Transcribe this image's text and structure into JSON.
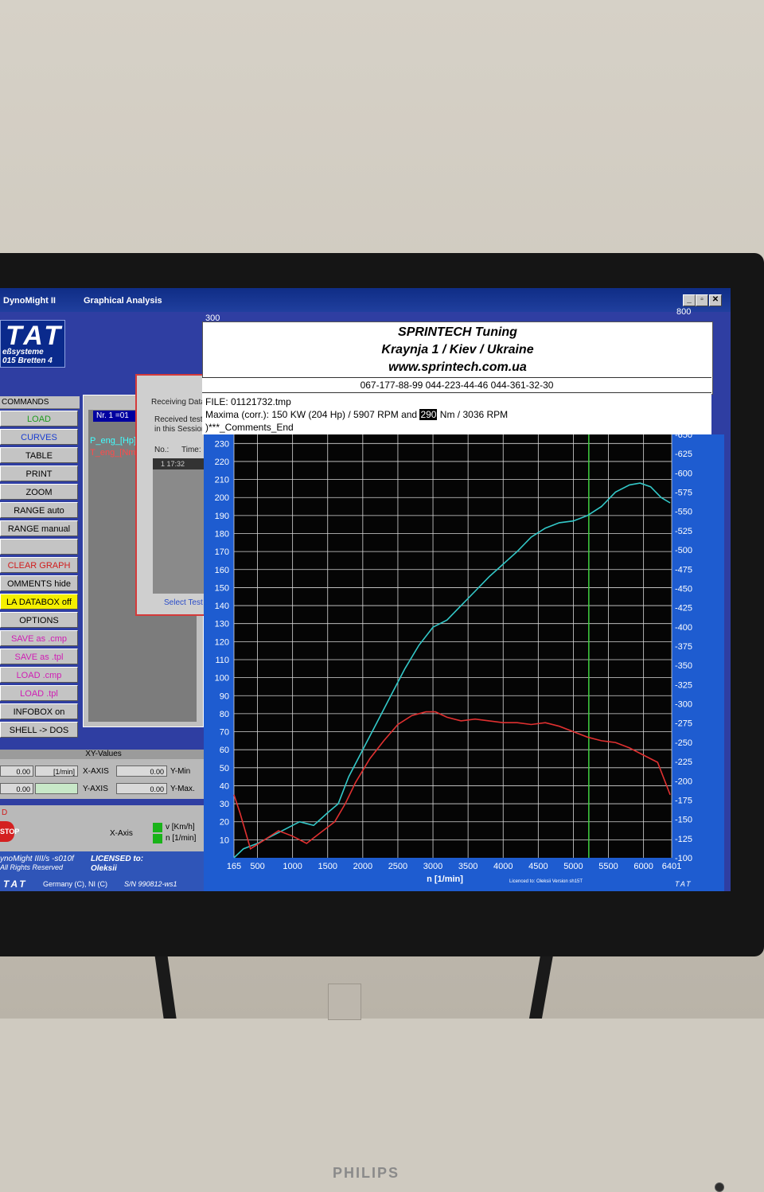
{
  "app": {
    "title": "DynoMight II",
    "menu_graphical": "Graphical Analysis",
    "logo_text": "TAT",
    "logo_sub1": "eßsysteme",
    "logo_sub2": "015 Bretten 4",
    "monitor_brand": "PHILIPS"
  },
  "window_buttons": [
    "_",
    "▫",
    "✕"
  ],
  "commands": {
    "header": "COMMANDS",
    "items": [
      {
        "label": "LOAD",
        "color": "#1e9a1e"
      },
      {
        "label": "CURVES",
        "color": "#1a3ed0"
      },
      {
        "label": "TABLE",
        "color": "#000000"
      },
      {
        "label": "PRINT",
        "color": "#000000"
      },
      {
        "label": "ZOOM",
        "color": "#000000"
      },
      {
        "label": "RANGE   auto",
        "color": "#000000"
      },
      {
        "label": "RANGE manual",
        "color": "#000000"
      },
      {
        "label": "",
        "color": "#000000"
      },
      {
        "label": "CLEAR GRAPH",
        "color": "#d01c1c"
      },
      {
        "label": "OMMENTS  hide",
        "color": "#000000"
      },
      {
        "label": "LA DATABOX  off",
        "color": "#000000",
        "bg": "#f5f000"
      },
      {
        "label": "OPTIONS",
        "color": "#000000"
      },
      {
        "label": "SAVE as .cmp",
        "color": "#d01cb4"
      },
      {
        "label": "SAVE as  .tpl",
        "color": "#d01cb4"
      },
      {
        "label": "LOAD  .cmp",
        "color": "#d01cb4"
      },
      {
        "label": "LOAD  .tpl",
        "color": "#d01cb4"
      },
      {
        "label": "INFOBOX on",
        "color": "#000000"
      },
      {
        "label": "SHELL -> DOS",
        "color": "#000000"
      }
    ]
  },
  "list_panel": {
    "nr": "Nr. 1 =01",
    "p_eng": "P_eng_[Hp]",
    "t_eng": "T_eng_[Nm"
  },
  "dialog": {
    "receiving": "Receiving Data",
    "received": "Received test",
    "session": "in this Session",
    "col_no": "No.:",
    "col_time": "Time:",
    "row": "1    17:32",
    "select": "Select Test"
  },
  "xy": {
    "header": "XY-Values",
    "val1": "0.00",
    "unit1": "[1/min]",
    "xaxis": "X-AXIS",
    "ymin_val": "0.00",
    "ymin": "Y-Min",
    "val2": "0.00",
    "yaxis": "Y-AXIS",
    "ymax_val": "0.00",
    "ymax": "Y-Max."
  },
  "bottom": {
    "top_label": "D",
    "stop": "STOP",
    "xaxis": "X-Axis",
    "v": "v  [Km/h]",
    "n": "n  [1/min]"
  },
  "footer": {
    "prog": "ynoMight IIII/s -s010f",
    "rights": "All Rights Reserved",
    "licensed": "LICENSED to:",
    "name": "Oleksii",
    "tat": "TAT",
    "country": "Germany (C), NI (C)",
    "sn": "S/N  990812-ws1"
  },
  "header_block": {
    "line1": "SPRINTECH Tuning",
    "line2": "Kraynja 1 / Kiev / Ukraine",
    "line3": "www.sprintech.com.ua",
    "phones": "067-177-88-99 044-223-44-46 044-361-32-30"
  },
  "info": {
    "file": "FILE:  01121732.tmp",
    "maxima_a": "Maxima (corr.):  150 KW (204 Hp) /  5907 RPM   and   ",
    "maxima_hl": "290",
    "maxima_b": " Nm /  3036 RPM",
    "comments": ")***_Comments_End"
  },
  "axis_top": {
    "left": "300",
    "right": "800"
  },
  "chart_data": {
    "type": "line",
    "title": "",
    "xlabel": "n  [1/min]",
    "ylabel": "",
    "x_ticks": [
      165,
      500,
      1000,
      1500,
      2000,
      2500,
      3000,
      3500,
      4000,
      4500,
      5000,
      5500,
      6000,
      6401
    ],
    "xlim": [
      165,
      6401
    ],
    "ylim_left": [
      0,
      235
    ],
    "yticks_left": [
      10,
      20,
      30,
      40,
      50,
      60,
      70,
      80,
      90,
      100,
      110,
      120,
      130,
      140,
      150,
      160,
      170,
      180,
      190,
      200,
      210,
      220,
      230
    ],
    "ylim_right": [
      100,
      650
    ],
    "yticks_right": [
      100,
      125,
      150,
      175,
      200,
      225,
      250,
      275,
      300,
      325,
      350,
      375,
      400,
      425,
      450,
      475,
      500,
      525,
      550,
      575,
      600,
      625,
      650
    ],
    "grid": true,
    "cursor_x": 5220,
    "footer_note": "Licenced to: Oleksii   Version sh15T",
    "footer_tat": "TAT",
    "series": [
      {
        "name": "P_eng_[Hp]",
        "axis": "left",
        "color": "#33c8c8",
        "x": [
          165,
          300,
          500,
          700,
          900,
          1100,
          1300,
          1500,
          1650,
          1800,
          2000,
          2200,
          2400,
          2600,
          2800,
          3000,
          3200,
          3400,
          3600,
          3800,
          4000,
          4200,
          4400,
          4600,
          4800,
          5000,
          5200,
          5400,
          5600,
          5800,
          5950,
          6100,
          6250,
          6380
        ],
        "y": [
          0,
          5,
          8,
          12,
          16,
          20,
          18,
          25,
          30,
          45,
          60,
          75,
          90,
          105,
          118,
          128,
          132,
          140,
          148,
          156,
          163,
          170,
          178,
          183,
          186,
          187,
          190,
          195,
          203,
          207,
          208,
          206,
          200,
          197
        ]
      },
      {
        "name": "T_eng_[Nm]",
        "axis": "left",
        "color": "#e03030",
        "x": [
          165,
          250,
          400,
          600,
          800,
          1000,
          1200,
          1400,
          1600,
          1750,
          1900,
          2100,
          2300,
          2500,
          2700,
          2900,
          3036,
          3200,
          3400,
          3600,
          3800,
          4000,
          4200,
          4400,
          4600,
          4800,
          5000,
          5200,
          5400,
          5600,
          5800,
          6000,
          6200,
          6380
        ],
        "y": [
          35,
          25,
          5,
          10,
          15,
          12,
          8,
          14,
          20,
          30,
          42,
          55,
          65,
          74,
          79,
          81,
          81,
          78,
          76,
          77,
          76,
          75,
          75,
          74,
          75,
          73,
          70,
          67,
          65,
          64,
          61,
          57,
          53,
          35
        ]
      }
    ]
  },
  "colors": {
    "screen_bg": "#2f3ea2",
    "plot_bg": "#050505",
    "grid": "#d8d8d8",
    "axis_panel": "#1e5cd0",
    "cursor": "#40d040"
  }
}
